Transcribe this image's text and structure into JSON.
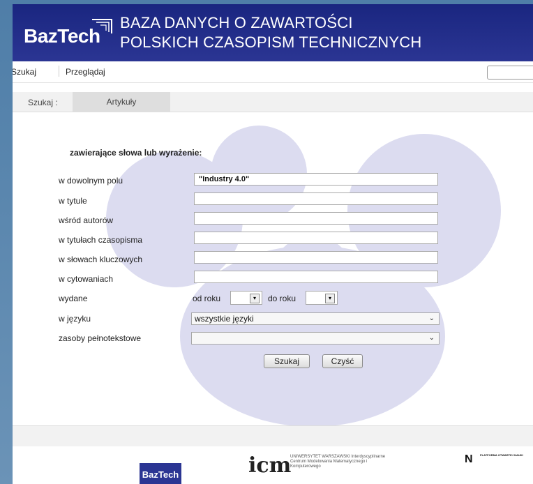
{
  "header": {
    "logo_text": "BazTech",
    "title_line1": "BAZA DANYCH O ZAWARTOŚCI",
    "title_line2": "POLSKICH CZASOPISM TECHNICZNYCH"
  },
  "nav": {
    "items": [
      "Szukaj",
      "Przeglądaj"
    ]
  },
  "tabs": {
    "label": "Szukaj :",
    "active_tab": "Artykuły"
  },
  "form": {
    "section_title": "zawierające słowa lub wyrażenie:",
    "fields": [
      {
        "label": "w dowolnym polu",
        "value": "\"Industry 4.0\""
      },
      {
        "label": "w tytule",
        "value": ""
      },
      {
        "label": "wśród autorów",
        "value": ""
      },
      {
        "label": "w tytułach czasopisma",
        "value": ""
      },
      {
        "label": "w słowach kluczowych",
        "value": ""
      },
      {
        "label": "w cytowaniach",
        "value": ""
      }
    ],
    "published": {
      "label": "wydane",
      "from_label": "od roku",
      "from_value": "",
      "to_label": "do roku",
      "to_value": ""
    },
    "language": {
      "label": "w języku",
      "selected": "wszystkie języki"
    },
    "fulltext": {
      "label": "zasoby pełnotekstowe",
      "selected": ""
    },
    "search_button": "Szukaj",
    "clear_button": "Czyść"
  },
  "footer": {
    "logo1": "BazTech",
    "logo2": "icm",
    "logo2_sub": "UNIWERSYTET WARSZAWSKI Interdyscyplinarne Centrum Modelowania Matematycznego i Komputerowego",
    "logo3": "N",
    "logo3_sub": "PLATFORMA OTWARTEJ NAUKI"
  },
  "colors": {
    "header_bg": "#1a2680",
    "blob": "#dcdcf0"
  }
}
